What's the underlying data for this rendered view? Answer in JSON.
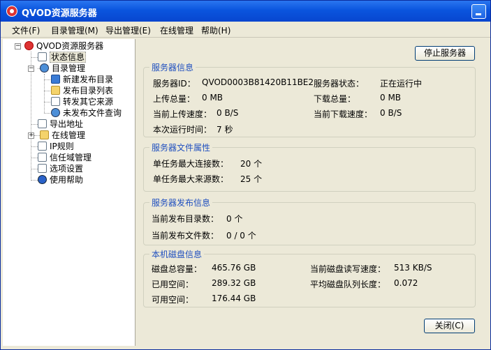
{
  "title": "QVOD资源服务器",
  "menu": [
    "文件(F)",
    "目录管理(M)",
    "导出管理(E)",
    "在线管理",
    "帮助(H)"
  ],
  "tree": {
    "root": "QVOD资源服务器",
    "status": "状态信息",
    "dir_mgmt": "目录管理",
    "new_dir": "新建发布目录",
    "dir_list": "发布目录列表",
    "forward": "转发其它来源",
    "unpublished": "未发布文件查询",
    "export": "导出地址",
    "online": "在线管理",
    "ip_rules": "IP规则",
    "trust": "信任域管理",
    "options": "选项设置",
    "help": "使用帮助"
  },
  "buttons": {
    "stop": "停止服务器",
    "close": "关闭(C)"
  },
  "server_info": {
    "title": "服务器信息",
    "id_label": "服务器ID：",
    "id_value": "QVOD0003B81420B11BE2",
    "status_label": "服务器状态：",
    "status_value": "正在运行中",
    "upload_total_label": "上传总量：",
    "upload_total_value": "0 MB",
    "download_total_label": "下载总量：",
    "download_total_value": "0 MB",
    "upload_speed_label": "当前上传速度：",
    "upload_speed_value": "0 B/S",
    "download_speed_label": "当前下载速度：",
    "download_speed_value": "0 B/S",
    "runtime_label": "本次运行时间：",
    "runtime_value": "7 秒"
  },
  "file_props": {
    "title": "服务器文件属性",
    "max_conn_label": "单任务最大连接数：",
    "max_conn_value": "20 个",
    "max_src_label": "单任务最大来源数：",
    "max_src_value": "25 个"
  },
  "publish_info": {
    "title": "服务器发布信息",
    "dir_count_label": "当前发布目录数：",
    "dir_count_value": "0 个",
    "file_count_label": "当前发布文件数：",
    "file_count_value": "0 / 0 个"
  },
  "disk_info": {
    "title": "本机磁盘信息",
    "total_label": "磁盘总容量：",
    "total_value": "465.76 GB",
    "rw_speed_label": "当前磁盘读写速度：",
    "rw_speed_value": "513 KB/S",
    "used_label": "已用空间：",
    "used_value": "289.32 GB",
    "queue_label": "平均磁盘队列长度：",
    "queue_value": "0.072",
    "free_label": "可用空间：",
    "free_value": "176.44 GB"
  }
}
